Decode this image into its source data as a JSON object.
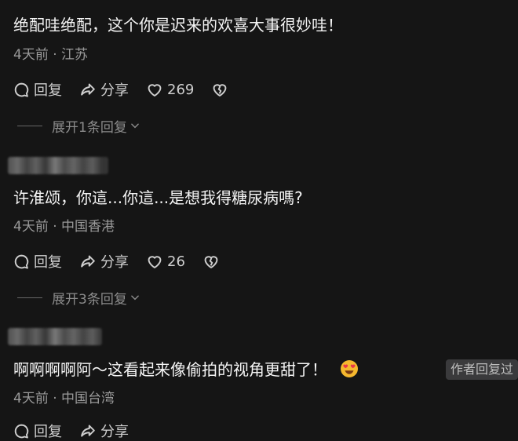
{
  "comments": [
    {
      "text": "绝配哇绝配，这个你是迟来的欢喜大事很妙哇！",
      "meta": "4天前 · 江苏",
      "reply_label": "回复",
      "share_label": "分享",
      "likes": "269",
      "expand_label": "展开1条回复"
    },
    {
      "text": "许淮颂，你這...你這...是想我得糖尿病嗎?",
      "meta": "4天前 · 中国香港",
      "reply_label": "回复",
      "share_label": "分享",
      "likes": "26",
      "expand_label": "展开3条回复"
    },
    {
      "text": "啊啊啊啊阿～这看起来像偷拍的视角更甜了！",
      "meta": "4天前 · 中国台湾",
      "badge": "作者回复过",
      "reply_label": "回复",
      "share_label": "分享"
    }
  ],
  "icons": {
    "reply": "comment-bubble-icon",
    "share": "share-arrow-icon",
    "like": "heart-icon",
    "dislike": "broken-heart-icon",
    "chevron": "chevron-down-icon",
    "emoji": "heart-eyes-emoji-icon"
  },
  "colors": {
    "background": "#151515",
    "text": "#f5f5f5",
    "meta": "#9a9a9a",
    "badge_bg": "#3a3a3c"
  }
}
